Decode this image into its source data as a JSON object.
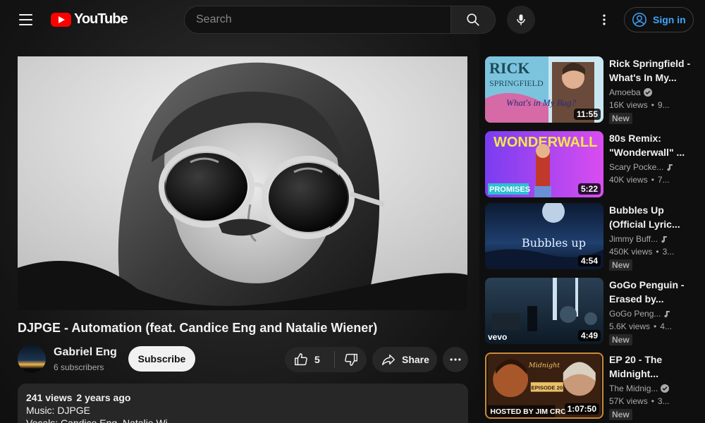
{
  "header": {
    "logo_text": "YouTube",
    "search_placeholder": "Search",
    "signin_label": "Sign in"
  },
  "video": {
    "title": "DJPGE - Automation (feat. Candice Eng and Natalie Wiener)",
    "channel_name": "Gabriel Eng",
    "subscribers": "6 subscribers",
    "subscribe_label": "Subscribe",
    "likes": "5",
    "share_label": "Share",
    "views": "241 views",
    "age": "2 years ago",
    "description_lines": [
      "Music: DJPGE",
      "Vocals: Candice Eng, Natalie Wi..."
    ]
  },
  "related": [
    {
      "title": "Rick Springfield - What's In My...",
      "channel": "Amoeba",
      "verified": true,
      "music": false,
      "views": "16K views",
      "age": "9...",
      "badge": "New",
      "duration": "11:55",
      "thumb_text": "RICK SPRINGFIELD",
      "thumb_colors": [
        "#c9e7f0",
        "#7cc4de",
        "#d9b060"
      ]
    },
    {
      "title": "80s Remix: \"Wonderwall\" ...",
      "channel": "Scary Pocke...",
      "verified": false,
      "music": true,
      "views": "40K views",
      "age": "7...",
      "badge": "",
      "duration": "5:22",
      "thumb_text": "WONDERWALL",
      "thumb_colors": [
        "#7a3df0",
        "#d94df0",
        "#f2e84a"
      ]
    },
    {
      "title": "Bubbles Up (Official Lyric...",
      "channel": "Jimmy Buff...",
      "verified": false,
      "music": true,
      "views": "450K views",
      "age": "3...",
      "badge": "New",
      "duration": "4:54",
      "thumb_text": "Bubbles up",
      "thumb_colors": [
        "#0c1a33",
        "#1f3f6e",
        "#5a86b8"
      ]
    },
    {
      "title": "GoGo Penguin - Erased by...",
      "channel": "GoGo Peng...",
      "verified": false,
      "music": true,
      "views": "5.6K views",
      "age": "4...",
      "badge": "New",
      "duration": "4:49",
      "thumb_text": "vevo",
      "thumb_colors": [
        "#0d1a26",
        "#2a4055",
        "#8aa0b2"
      ]
    },
    {
      "title": "EP 20 - The Midnight...",
      "channel": "The Midnig...",
      "verified": true,
      "music": false,
      "views": "57K views",
      "age": "3...",
      "badge": "New",
      "duration": "1:07:50",
      "thumb_text": "EPISODE 20",
      "thumb_colors": [
        "#3a2010",
        "#a8572a",
        "#e9c26a"
      ]
    }
  ],
  "icons": {
    "menu": "menu-icon",
    "search": "search-icon",
    "mic": "mic-icon",
    "more": "more-vert-icon",
    "account": "account-icon",
    "like": "thumb-up-icon",
    "dislike": "thumb-down-icon",
    "share": "share-icon",
    "more_actions": "more-horiz-icon",
    "verified": "verified-icon",
    "music": "music-note-icon"
  },
  "colors": {
    "accent": "#ff0000",
    "link": "#3ea6ff",
    "bg": "#0f0f0f"
  }
}
